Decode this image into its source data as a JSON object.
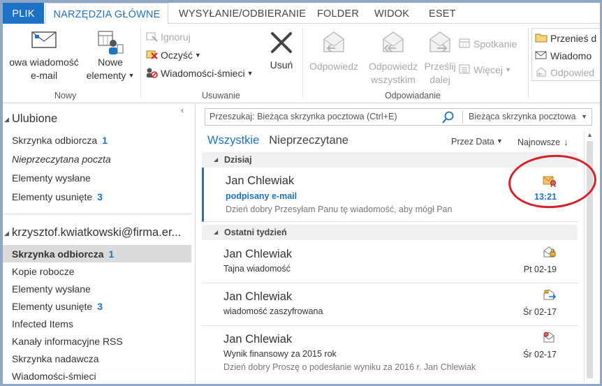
{
  "tabs": [
    {
      "label": "PLIK"
    },
    {
      "label": "NARZĘDZIA GŁÓWNE"
    },
    {
      "label": "WYSYŁANIE/ODBIERANIE"
    },
    {
      "label": "FOLDER"
    },
    {
      "label": "WIDOK"
    },
    {
      "label": "ESET"
    }
  ],
  "ribbon": {
    "new_group": {
      "label": "Nowy",
      "new_email_line1": "owa wiadomość",
      "new_email_line2": "e-mail",
      "new_items_line1": "Nowe",
      "new_items_line2": "elementy"
    },
    "delete_group": {
      "label": "Usuwanie",
      "ignore": "Ignoruj",
      "clean": "Oczyść",
      "junk": "Wiadomości-śmieci",
      "delete": "Usuń"
    },
    "respond_group": {
      "label": "Odpowiadanie",
      "reply": "Odpowiedz",
      "reply_all_line1": "Odpowiedz",
      "reply_all_line2": "wszystkim",
      "forward_line1": "Prześlij",
      "forward_line2": "dalej",
      "meeting": "Spotkanie",
      "more": "Więcej"
    },
    "quick_steps": {
      "move": "Przenieś d",
      "message": "Wiadomo",
      "reply": "Odpowied"
    }
  },
  "left": {
    "favorites_header": "Ulubione",
    "favorites": [
      {
        "label": "Skrzynka odbiorcza",
        "count": "1"
      },
      {
        "label": "Nieprzeczytana poczta",
        "count": ""
      },
      {
        "label": "Elementy wysłane",
        "count": ""
      },
      {
        "label": "Elementy usunięte",
        "count": "3"
      }
    ],
    "account": "krzysztof.kwiatkowski@firma.er...",
    "folders": [
      {
        "label": "Skrzynka odbiorcza",
        "count": "1"
      },
      {
        "label": "Kopie robocze",
        "count": ""
      },
      {
        "label": "Elementy wysłane",
        "count": ""
      },
      {
        "label": "Elementy usunięte",
        "count": "3"
      },
      {
        "label": "Infected Items",
        "count": ""
      },
      {
        "label": "Kanały informacyjne RSS",
        "count": ""
      },
      {
        "label": "Skrzynka nadawcza",
        "count": ""
      },
      {
        "label": "Wiadomości-śmieci",
        "count": ""
      }
    ]
  },
  "search": {
    "placeholder": "Przeszukaj: Bieżąca skrzynka pocztowa (Ctrl+E)",
    "scope": "Bieżąca skrzynka pocztowa"
  },
  "list": {
    "filter_all": "Wszystkie",
    "filter_unread": "Nieprzeczytane",
    "sort_by": "Przez Data",
    "sort_order": "Najnowsze",
    "groups": [
      {
        "label": "Dzisiaj"
      },
      {
        "label": "Ostatni tydzień"
      }
    ],
    "messages": [
      {
        "from": "Jan Chlewiak",
        "subject": "podpisany e-mail",
        "preview": "Dzień dobry  Przesyłam Panu tę wiadomość, aby mógł Pan",
        "date": "13:21",
        "icon": "signed-envelope-icon"
      },
      {
        "from": "Jan Chlewiak",
        "subject": "Tajna wiadomość",
        "preview": "",
        "date": "Pt 02-19",
        "icon": "encrypted-envelope-icon"
      },
      {
        "from": "Jan Chlewiak",
        "subject": "wiadomość zaszyfrowana",
        "preview": "",
        "date": "Śr 02-17",
        "icon": "encrypted-forwarded-icon"
      },
      {
        "from": "Jan Chlewiak",
        "subject": "Wynik finansowy za 2015 rok",
        "preview": "Dzień dobry  Proszę o podesłanie wyniku za 2016 r.  Jan Chlewiak",
        "date": "Śr 02-17",
        "icon": "signed-open-envelope-icon"
      }
    ]
  },
  "colors": {
    "accent": "#1e72c6",
    "annotation": "#d6202a"
  }
}
